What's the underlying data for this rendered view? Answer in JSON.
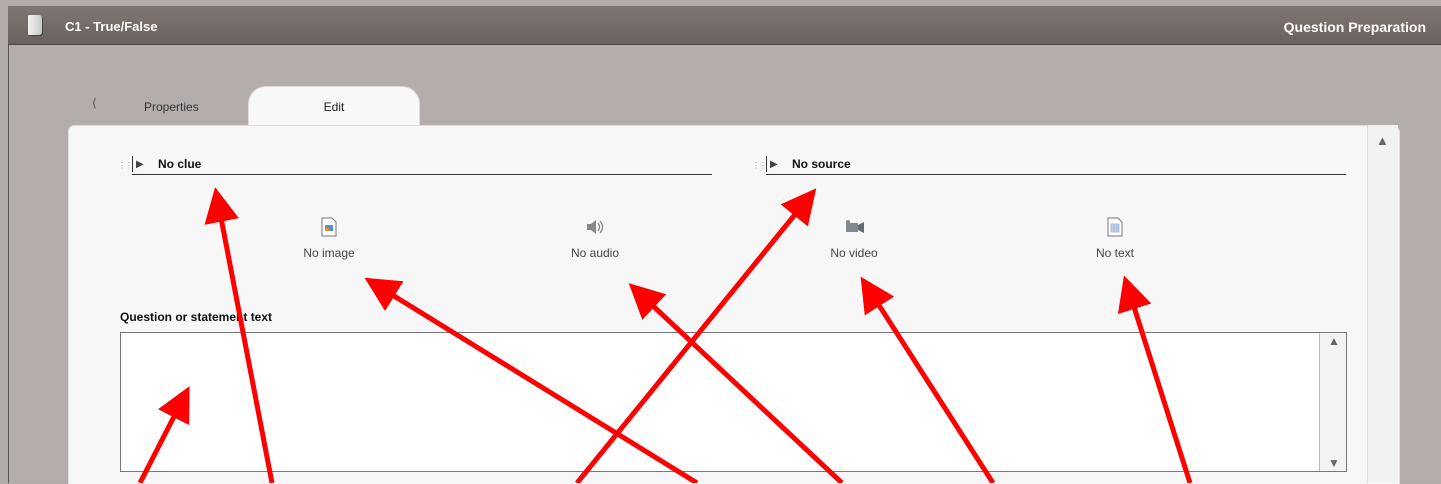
{
  "window": {
    "title": "C1 - True/False",
    "section": "Question Preparation"
  },
  "tabs": {
    "prev_glyph": "⟨",
    "properties": "Properties",
    "edit": "Edit"
  },
  "accordions": {
    "clue": "No clue",
    "source": "No source"
  },
  "media": {
    "image": "No image",
    "audio": "No audio",
    "video": "No video",
    "text": "No text"
  },
  "question": {
    "label": "Question or statement text",
    "value": ""
  },
  "annotation": {
    "arrow_color": "#ff0000"
  },
  "colors": {
    "titlebar": "#736a68",
    "background": "#b5adac",
    "panel": "#f8f7f7"
  }
}
